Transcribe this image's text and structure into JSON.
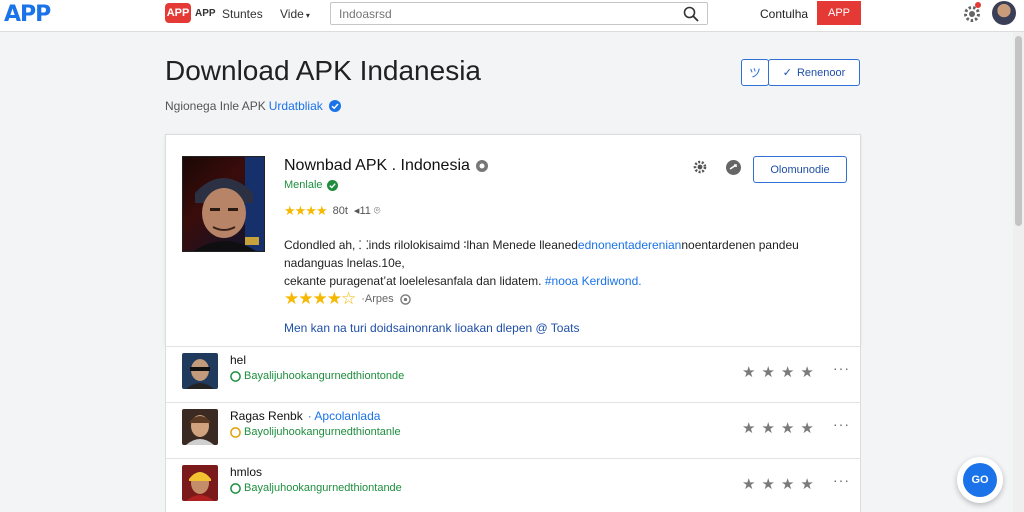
{
  "topbar": {
    "logo": "APP",
    "brand_badge": "APP",
    "brand_text": "APP",
    "nav": [
      "Stuntes",
      "Vide"
    ],
    "search_placeholder": "Indoasrsd",
    "contact": "Contulha",
    "red_button": "APP",
    "icons": [
      "search-icon",
      "gear-icon",
      "avatar"
    ]
  },
  "header": {
    "title": "Download APK Indanesia",
    "subtitle": "Ngionega Inle APK",
    "subtitle_link": "Urdatbliak",
    "button_icon": "ツ",
    "button_label": "Renenoor"
  },
  "card": {
    "app_name": "Nownbad APK . Indonesia",
    "developer": "Menlale",
    "rating_stars": "★★★★",
    "rating_text": "80t",
    "rating_extra": "◂11 ⌾",
    "description_lines": [
      "Cdondled ah, ⸬inds rilolokisaimd ∶lhan Menede lleaned",
      "noentardenen pandeu nadanguas lnelas.10e,",
      "cekante puragenat’at loelelesanfala dan lidatem. "
    ],
    "description_link_1": "ednonentaderenian",
    "description_link_2": "#nooa Kerdiwond.",
    "rating2_stars": "★★★★☆",
    "rating2_text": "·Arpes",
    "more_link": "Men kan na turi doidsainonrank lioakan dlepen @ Toats",
    "button_label": "Olomunodie"
  },
  "reviews": [
    {
      "name": "hel",
      "tag": "",
      "meta": "Bayalijuhookangurnedthiontonde",
      "stars": "★★★★",
      "more": "···"
    },
    {
      "name": "Ragas Renbk",
      "tag": "· Apcolanlada",
      "meta": "Bayolijuhookangurnedthiontanle",
      "stars": "★★★★",
      "more": "···"
    },
    {
      "name": "hmlos",
      "tag": "",
      "meta": "Bayaljuhookangurnedthiontande",
      "stars": "★★★★",
      "more": "···"
    }
  ],
  "fab": {
    "label": "GO"
  },
  "colors": {
    "accent": "#1a73e8",
    "brand_red": "#e53935",
    "green": "#1e8e3e",
    "star": "#f6b800"
  }
}
